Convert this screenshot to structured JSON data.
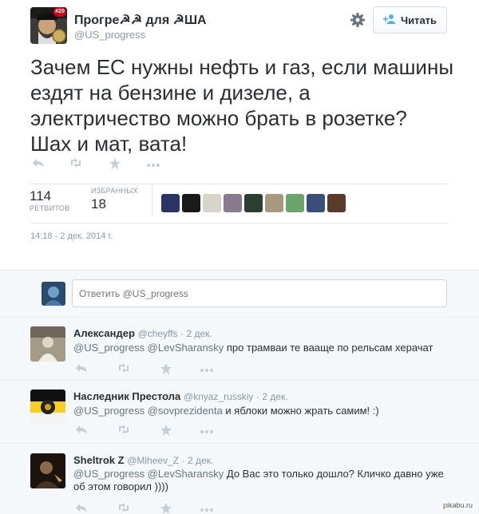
{
  "tweet": {
    "author_name": "Прогре☭☭ для ☭ША",
    "author_handle": "@US_progress",
    "avatar_badge": "#20",
    "follow_label": "Читать",
    "text": "Зачем ЕС нужны нефть и газ, если машины ездят на бензине и дизеле, а электричество можно брать в розетке? Шах и мат, вата!",
    "retweets_count": "114",
    "retweets_label": "РЕТВИТОВ",
    "favorites_count": "18",
    "favorites_label": "ИЗБРАННЫХ",
    "timestamp": "14:18 - 2 дек. 2014 г.",
    "actions": [
      "reply-icon",
      "retweet-icon",
      "favorite-icon",
      "more-icon"
    ]
  },
  "favoriters": [
    {
      "color": "#2a3466"
    },
    {
      "color": "#1a1a1a"
    },
    {
      "color": "#d8d4cc"
    },
    {
      "color": "#8a7a90"
    },
    {
      "color": "#2b4030"
    },
    {
      "color": "#a89880"
    },
    {
      "color": "#6aa56a"
    },
    {
      "color": "#3a4f7a"
    },
    {
      "color": "#5a3a28"
    }
  ],
  "reply_box": {
    "placeholder": "Ответить @US_progress"
  },
  "replies": [
    {
      "name": "Александер",
      "handle": "@cheyffs",
      "date": "· 2 дек.",
      "mentions": "@US_progress @LevSharansky",
      "text": " про трамваи те вааще по рельсам херачат",
      "avatar_color": "#8a8070"
    },
    {
      "name": "Наследник Престола",
      "handle": "@knyaz_russkiy",
      "date": "· 2 дек.",
      "mentions": "@US_progress @sovprezidenta",
      "text": " и яблоки можно жрать самим! :)",
      "avatar_color": "#1a1a1a"
    },
    {
      "name": "Sheltrok Z",
      "handle": "@Miheev_Z",
      "date": "· 2 дек.",
      "mentions": "@US_progress @LevSharansky",
      "text": " До Вас это только дошло? Кличко давно уже об этом говорил ))))",
      "avatar_color": "#3a2a1a"
    }
  ],
  "watermark": "pikabu.ru",
  "colors": {
    "accent": "#55acee",
    "muted": "#8899a6",
    "background_alt": "#f5f8fa"
  }
}
